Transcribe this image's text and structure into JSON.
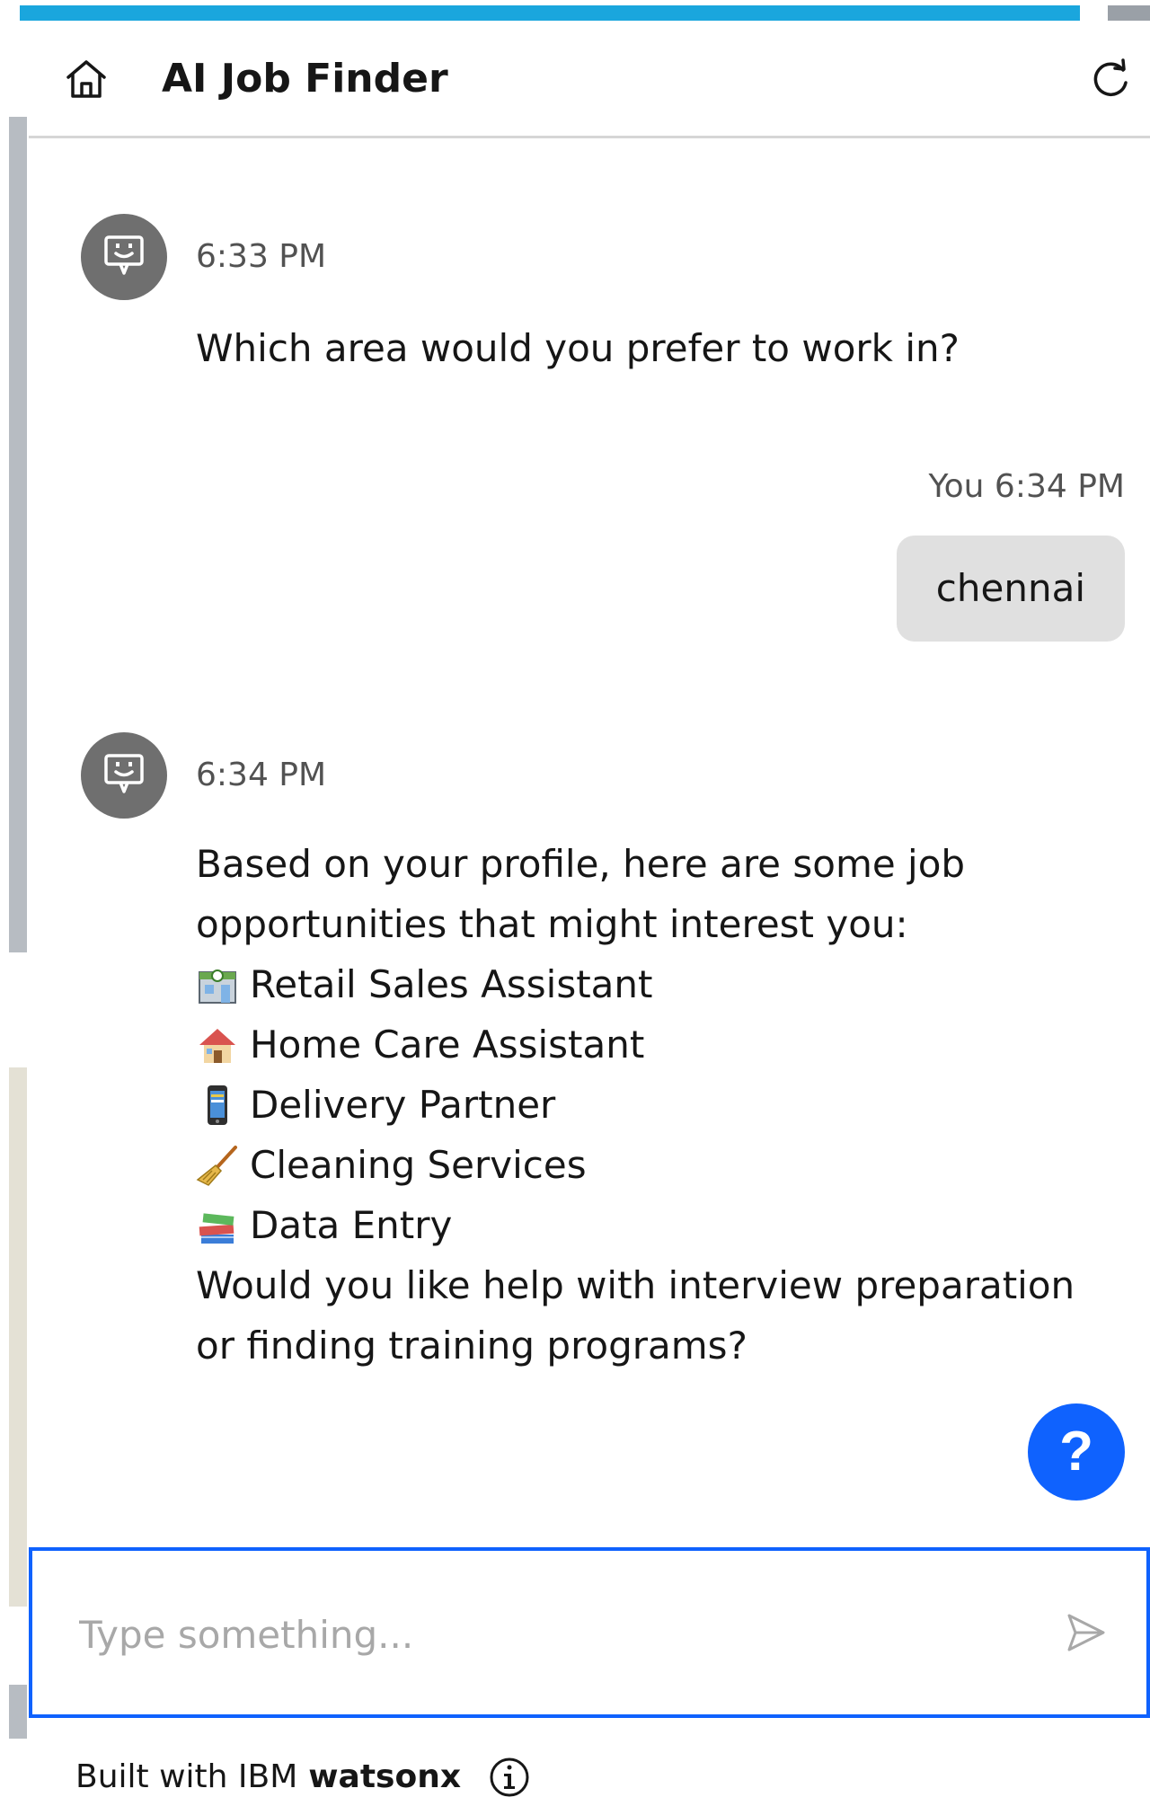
{
  "header": {
    "title": "AI Job Finder",
    "home_icon": "home-icon",
    "refresh_icon": "refresh-icon"
  },
  "messages": [
    {
      "sender": "bot",
      "time": "6:33 PM",
      "text": "Which area would you prefer to work in?"
    },
    {
      "sender": "user",
      "time": "You 6:34 PM",
      "text": "chennai"
    },
    {
      "sender": "bot",
      "time": "6:34 PM",
      "intro_line1": "Based on your profile, here are some job",
      "intro_line2": "opportunities that might interest you:",
      "jobs": [
        {
          "icon": "store-icon",
          "label": "Retail Sales Assistant"
        },
        {
          "icon": "house-icon",
          "label": "Home Care Assistant"
        },
        {
          "icon": "phone-icon",
          "label": "Delivery Partner"
        },
        {
          "icon": "broom-icon",
          "label": "Cleaning Services"
        },
        {
          "icon": "books-icon",
          "label": "Data Entry"
        }
      ],
      "outro_line1": "Would you like help with interview preparation",
      "outro_line2": "or finding training programs?"
    }
  ],
  "help_button": {
    "label": "?"
  },
  "input": {
    "placeholder": "Type something...",
    "value": ""
  },
  "footer": {
    "text": "Built with IBM",
    "brand": "watsonx"
  },
  "colors": {
    "accent": "#0f62fe",
    "progress": "#1aa6dd",
    "avatar": "#6f6f6f",
    "user_bubble": "#e0e0e0"
  }
}
